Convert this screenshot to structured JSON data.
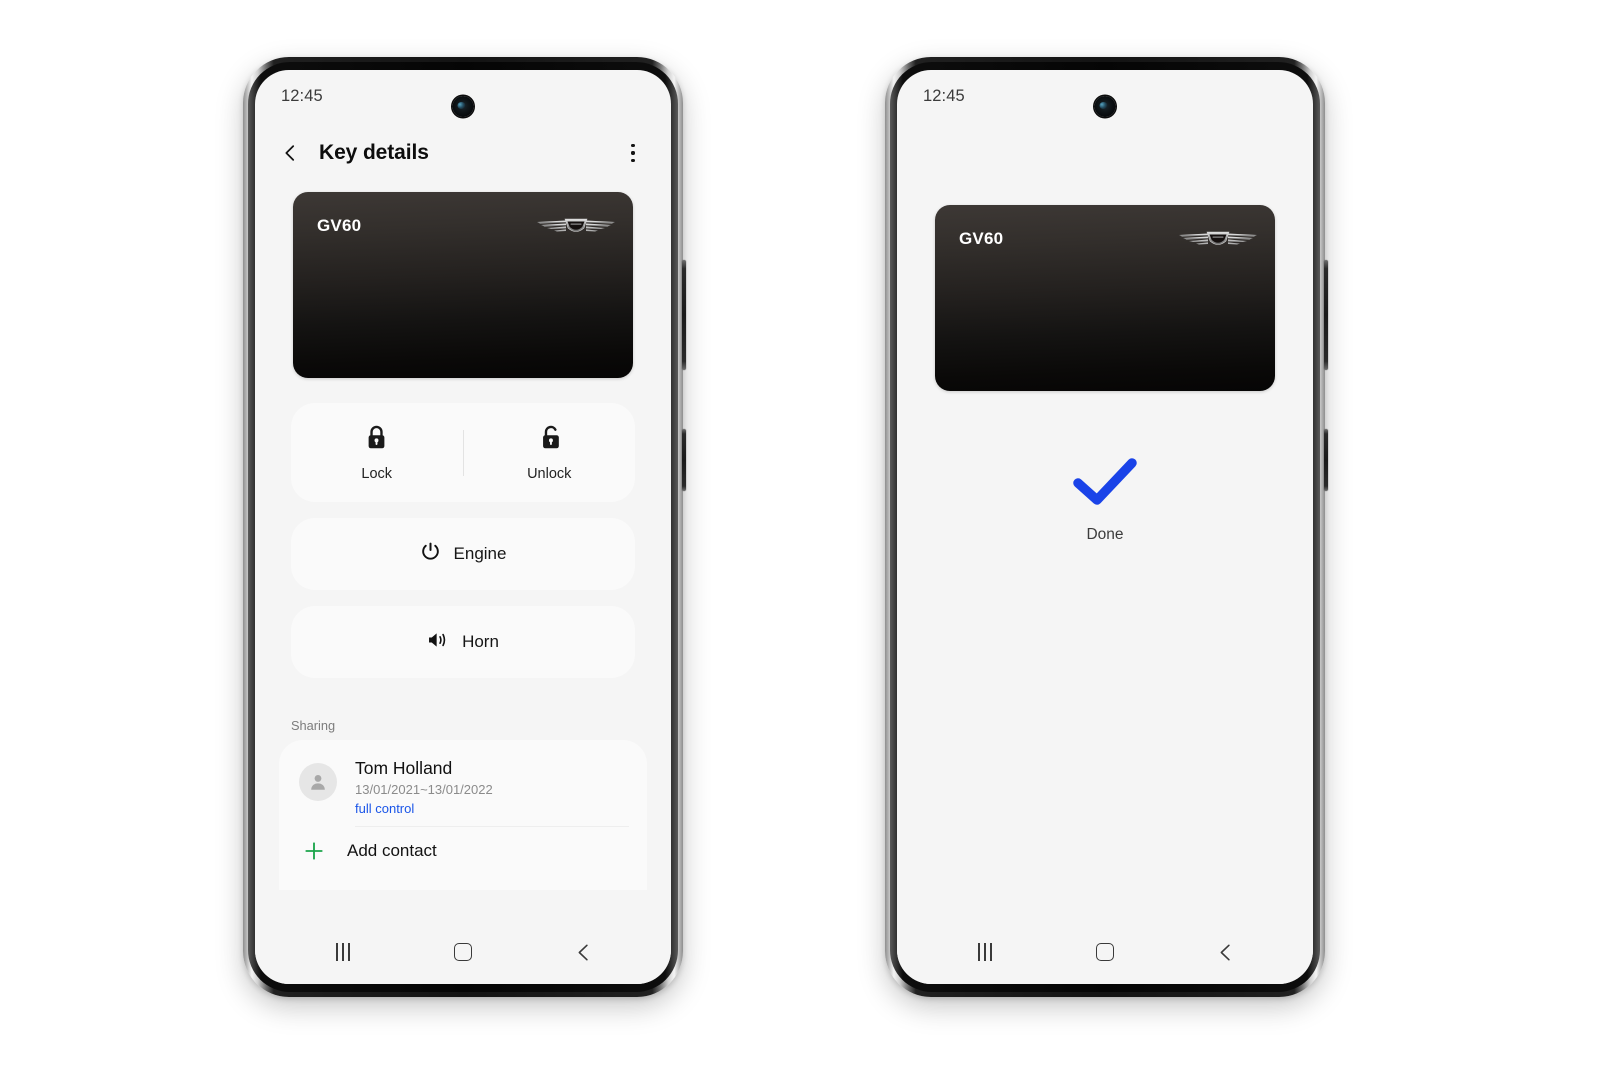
{
  "left_phone": {
    "status": {
      "time": "12:45"
    },
    "app_bar": {
      "back_icon": "chevron-left-icon",
      "title": "Key details",
      "menu_icon": "more-vertical-icon"
    },
    "car_card": {
      "model": "GV60",
      "brand_logo": "genesis-wings-logo",
      "gradient_top": "#3d3835",
      "gradient_bottom": "#060505"
    },
    "controls": {
      "lock": {
        "label": "Lock",
        "icon": "lock-closed-icon"
      },
      "unlock": {
        "label": "Unlock",
        "icon": "lock-open-icon"
      },
      "engine": {
        "label": "Engine",
        "icon": "power-icon"
      },
      "horn": {
        "label": "Horn",
        "icon": "speaker-sound-icon"
      }
    },
    "sharing": {
      "title": "Sharing",
      "contacts": [
        {
          "name": "Tom Holland",
          "dates": "13/01/2021~13/01/2022",
          "permission": "full control",
          "permission_color": "#1a55e8",
          "avatar_icon": "person-avatar-icon"
        }
      ],
      "add_contact": {
        "label": "Add contact",
        "icon": "plus-icon",
        "icon_color": "#1aa44a"
      }
    },
    "nav_bar": {
      "recents_icon": "recents-icon",
      "home_icon": "home-icon",
      "back_icon": "back-icon"
    }
  },
  "right_phone": {
    "status": {
      "time": "12:45"
    },
    "car_card": {
      "model": "GV60",
      "brand_logo": "genesis-wings-logo"
    },
    "result": {
      "icon": "checkmark-icon",
      "icon_color": "#1a43e8",
      "label": "Done"
    },
    "nav_bar": {
      "recents_icon": "recents-icon",
      "home_icon": "home-icon",
      "back_icon": "back-icon"
    }
  }
}
